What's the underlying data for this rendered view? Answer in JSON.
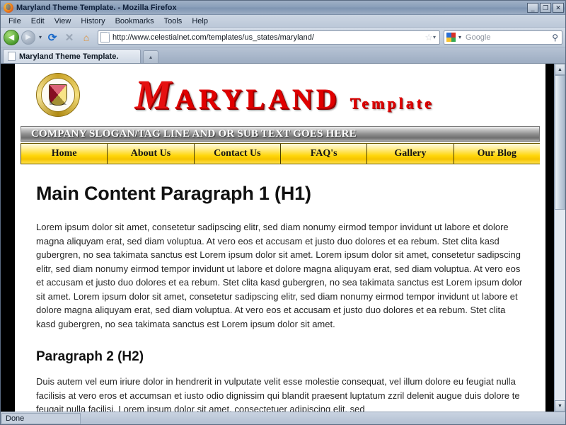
{
  "browser": {
    "title": "Maryland Theme Template. - Mozilla Firefox",
    "window_controls": {
      "minimize": "_",
      "restore": "❐",
      "close": "✕"
    },
    "menus": [
      "File",
      "Edit",
      "View",
      "History",
      "Bookmarks",
      "Tools",
      "Help"
    ],
    "toolbar": {
      "back": "◀",
      "forward": "▶",
      "dropdown_caret": "▾",
      "reload": "⟳",
      "stop": "✕",
      "home": "⌂"
    },
    "url": "http://www.celestialnet.com/templates/us_states/maryland/",
    "url_star": "☆",
    "url_caret": "▾",
    "search": {
      "placeholder": "Google",
      "value": "",
      "engine_caret": "▾",
      "magnifier": "⚲"
    },
    "tabs": [
      {
        "label": "Maryland Theme Template."
      }
    ],
    "tab_list_caret": "▴",
    "status": "Done",
    "scrollbar": {
      "up": "▲",
      "down": "▼"
    }
  },
  "page": {
    "logo": {
      "initial": "M",
      "main_rest": "ARYLAND",
      "sub": "Template"
    },
    "seal_alt": "maryland-state-seal",
    "slogan": "COMPANY SLOGAN/TAG LINE AND OR SUB TEXT GOES HERE",
    "nav": [
      {
        "label": "Home"
      },
      {
        "label": "About Us"
      },
      {
        "label": "Contact Us"
      },
      {
        "label": "FAQ's"
      },
      {
        "label": "Gallery"
      },
      {
        "label": "Our Blog"
      }
    ],
    "h1": "Main Content Paragraph 1 (H1)",
    "paragraph1": "Lorem ipsum dolor sit amet, consetetur sadipscing elitr, sed diam nonumy eirmod tempor invidunt ut labore et dolore magna aliquyam erat, sed diam voluptua. At vero eos et accusam et justo duo dolores et ea rebum. Stet clita kasd gubergren, no sea takimata sanctus est Lorem ipsum dolor sit amet. Lorem ipsum dolor sit amet, consetetur sadipscing elitr, sed diam nonumy eirmod tempor invidunt ut labore et dolore magna aliquyam erat, sed diam voluptua. At vero eos et accusam et justo duo dolores et ea rebum. Stet clita kasd gubergren, no sea takimata sanctus est Lorem ipsum dolor sit amet. Lorem ipsum dolor sit amet, consetetur sadipscing elitr, sed diam nonumy eirmod tempor invidunt ut labore et dolore magna aliquyam erat, sed diam voluptua. At vero eos et accusam et justo duo dolores et ea rebum. Stet clita kasd gubergren, no sea takimata sanctus est Lorem ipsum dolor sit amet.",
    "h2": "Paragraph 2 (H2)",
    "paragraph2": "Duis autem vel eum iriure dolor in hendrerit in vulputate velit esse molestie consequat, vel illum dolore eu feugiat nulla facilisis at vero eros et accumsan et iusto odio dignissim qui blandit praesent luptatum zzril delenit augue duis dolore te feugait nulla facilisi. Lorem ipsum dolor sit amet, consectetuer adipiscing elit, sed"
  },
  "colors": {
    "nav_gold": "#ffd60a",
    "logo_red": "#e00000",
    "page_background": "#000000",
    "content_background": "#ffffff"
  }
}
